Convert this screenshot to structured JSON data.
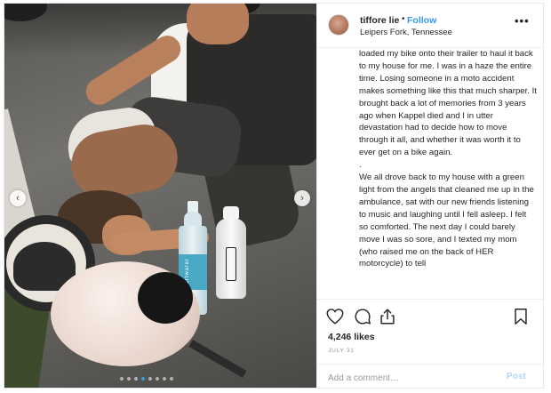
{
  "profile": {
    "username": "tiffore lie",
    "separator": "•",
    "follow_label": "Follow",
    "location": "Leipers Fork, Tennessee",
    "more_label": "•••"
  },
  "caption": {
    "paragraphs": [
      "loaded my bike onto their trailer to haul it back to my house for me. I was in a haze the entire time. Losing someone in a moto accident makes something like this that much sharper. It brought back a lot of memories from 3 years ago when Kappel died and I in utter devastation had to decide how to move through it all, and whether it was worth it to ever get on a bike again.",
      ".",
      "We all drove back to my house with a green light from the angels that cleaned me up in the ambulance, sat with our new friends listening to music and laughing until I fell asleep. I felt so comforted. The next day I could barely move I was so sore, and I texted my mom (who raised me on the back of HER motorcycle) to tell"
    ]
  },
  "photo": {
    "bottle_label": "smartwater",
    "dots": [
      false,
      false,
      false,
      true,
      false,
      false,
      false,
      false
    ]
  },
  "actions": {
    "likes": "4,246 likes",
    "date": "JULY 31",
    "comment_placeholder": "Add a comment…",
    "post_label": "Post"
  },
  "colors": {
    "accent": "#3897f0",
    "post_disabled": "#b3d4f5",
    "muted": "#999999",
    "border": "#efefef"
  },
  "icons": {
    "like": "heart-icon",
    "comment": "comment-icon",
    "share": "share-icon",
    "save": "bookmark-icon",
    "prev": "chevron-left-icon",
    "next": "chevron-right-icon"
  }
}
